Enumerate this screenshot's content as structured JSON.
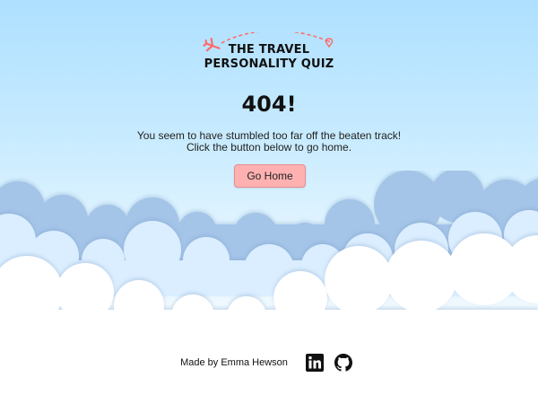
{
  "logo": {
    "line1": "THE TRAVEL",
    "line2": "PERSONALITY QUIZ",
    "plane_color": "#ff6b6b",
    "path_color": "#ff6b6b"
  },
  "error": {
    "title": "404!",
    "message_line1": "You seem to have stumbled too far off the beaten track!",
    "message_line2": "Click the button below to go home."
  },
  "button": {
    "label": "Go Home",
    "color": "#ffb1b1"
  },
  "footer": {
    "credit": "Made by Emma Hewson",
    "links": [
      {
        "icon": "linkedin-icon"
      },
      {
        "icon": "github-icon"
      }
    ]
  },
  "colors": {
    "sky_top": "#aee0ff",
    "cloud_back": "#a4c4e8",
    "cloud_mid": "#dbeeff",
    "cloud_front": "#ffffff"
  }
}
